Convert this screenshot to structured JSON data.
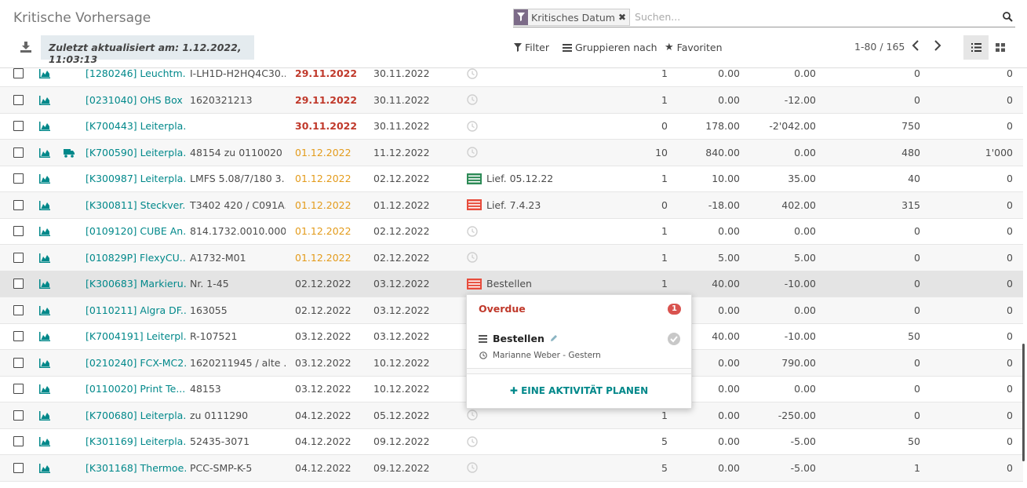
{
  "header": {
    "title": "Kritische Vorhersage",
    "facet_label": "Kritisches Datum",
    "search_placeholder": "Suchen...",
    "updated_label": "Zuletzt aktualisiert am: 1.12.2022, 11:03:13",
    "filter_label": "Filter",
    "group_label": "Gruppieren nach",
    "favorites_label": "Favoriten",
    "pager": "1-80 / 165"
  },
  "colors": {
    "accent": "#00888a",
    "overdue_red": "#c0392b",
    "warning_orange": "#e39b1b",
    "facet_purple": "#7c6b88"
  },
  "rows": [
    {
      "name": "[1280246] Leuchtm...",
      "ref": "I-LH1D-H2HQ4C30...",
      "date1": "29.11.2022",
      "date1_style": "red",
      "date2": "30.11.2022",
      "activity_icon": "clock-icon",
      "activity_label": "",
      "n1": "1",
      "n2": "0.00",
      "n3": "0.00",
      "n4": "0",
      "n5": "0",
      "truck": false
    },
    {
      "name": "[0231040] OHS Box ...",
      "ref": "1620321213",
      "date1": "29.11.2022",
      "date1_style": "red",
      "date2": "30.11.2022",
      "activity_icon": "clock-icon",
      "activity_label": "",
      "n1": "1",
      "n2": "0.00",
      "n3": "-12.00",
      "n4": "0",
      "n5": "0",
      "truck": false
    },
    {
      "name": "[K700443] Leiterpla...",
      "ref": "",
      "date1": "30.11.2022",
      "date1_style": "red",
      "date2": "30.11.2022",
      "activity_icon": "clock-icon",
      "activity_label": "",
      "n1": "0",
      "n2": "178.00",
      "n3": "-2'042.00",
      "n4": "750",
      "n5": "0",
      "truck": false
    },
    {
      "name": "[K700590] Leiterpla...",
      "ref": "48154 zu 0110020",
      "date1": "01.12.2022",
      "date1_style": "orange",
      "date2": "11.12.2022",
      "activity_icon": "clock-icon",
      "activity_label": "",
      "n1": "10",
      "n2": "840.00",
      "n3": "0.00",
      "n4": "480",
      "n5": "1'000",
      "truck": true
    },
    {
      "name": "[K300987] Leiterpla...",
      "ref": "LMFS 5.08/7/180 3...",
      "date1": "01.12.2022",
      "date1_style": "orange",
      "date2": "02.12.2022",
      "activity_icon": "list-green-icon",
      "activity_label": "Lief. 05.12.22",
      "n1": "1",
      "n2": "10.00",
      "n3": "35.00",
      "n4": "40",
      "n5": "0",
      "truck": false
    },
    {
      "name": "[K300811] Steckver...",
      "ref": "T3402 420 / C091A...",
      "date1": "01.12.2022",
      "date1_style": "orange",
      "date2": "01.12.2022",
      "activity_icon": "list-red-icon",
      "activity_label": "Lief. 7.4.23",
      "n1": "0",
      "n2": "-18.00",
      "n3": "402.00",
      "n4": "315",
      "n5": "0",
      "truck": false
    },
    {
      "name": "[0109120] CUBE An...",
      "ref": "814.1732.0010.000",
      "date1": "01.12.2022",
      "date1_style": "orange",
      "date2": "02.12.2022",
      "activity_icon": "clock-icon",
      "activity_label": "",
      "n1": "1",
      "n2": "0.00",
      "n3": "0.00",
      "n4": "0",
      "n5": "0",
      "truck": false
    },
    {
      "name": "[010829P] FlexyCU...",
      "ref": "A1732-M01",
      "date1": "01.12.2022",
      "date1_style": "orange",
      "date2": "02.12.2022",
      "activity_icon": "clock-icon",
      "activity_label": "",
      "n1": "1",
      "n2": "5.00",
      "n3": "5.00",
      "n4": "0",
      "n5": "0",
      "truck": false
    },
    {
      "name": "[K300683] Markieru...",
      "ref": "Nr. 1-45",
      "date1": "02.12.2022",
      "date1_style": "",
      "date2": "03.12.2022",
      "activity_icon": "list-red-icon",
      "activity_label": "Bestellen",
      "n1": "1",
      "n2": "40.00",
      "n3": "-10.00",
      "n4": "0",
      "n5": "0",
      "truck": false
    },
    {
      "name": "[0110211] Algra DF...",
      "ref": "163055",
      "date1": "02.12.2022",
      "date1_style": "",
      "date2": "03.12.2022",
      "activity_icon": "clock-icon",
      "activity_label": "",
      "n1": "",
      "n2": "0.00",
      "n3": "0.00",
      "n4": "0",
      "n5": "0",
      "truck": false
    },
    {
      "name": "[K7004191] Leiterpl...",
      "ref": "R-107521",
      "date1": "03.12.2022",
      "date1_style": "",
      "date2": "03.12.2022",
      "activity_icon": "clock-icon",
      "activity_label": "",
      "n1": "",
      "n2": "40.00",
      "n3": "-10.00",
      "n4": "50",
      "n5": "0",
      "truck": false
    },
    {
      "name": "[0210240] FCX-MC2...",
      "ref": "1620211945 / alte ...",
      "date1": "03.12.2022",
      "date1_style": "",
      "date2": "10.12.2022",
      "activity_icon": "clock-icon",
      "activity_label": "",
      "n1": "",
      "n2": "0.00",
      "n3": "790.00",
      "n4": "0",
      "n5": "0",
      "truck": false
    },
    {
      "name": "[0110020] Print Te...",
      "ref": "48153",
      "date1": "03.12.2022",
      "date1_style": "",
      "date2": "10.12.2022",
      "activity_icon": "clock-icon",
      "activity_label": "",
      "n1": "",
      "n2": "0.00",
      "n3": "0.00",
      "n4": "0",
      "n5": "0",
      "truck": false
    },
    {
      "name": "[K700680] Leiterpla...",
      "ref": "zu 0111290",
      "date1": "04.12.2022",
      "date1_style": "",
      "date2": "05.12.2022",
      "activity_icon": "clock-icon",
      "activity_label": "",
      "n1": "1",
      "n2": "0.00",
      "n3": "-250.00",
      "n4": "0",
      "n5": "0",
      "truck": false
    },
    {
      "name": "[K301169] Leiterpla...",
      "ref": "52435-3071",
      "date1": "04.12.2022",
      "date1_style": "",
      "date2": "09.12.2022",
      "activity_icon": "clock-icon",
      "activity_label": "",
      "n1": "5",
      "n2": "0.00",
      "n3": "-5.00",
      "n4": "50",
      "n5": "0",
      "truck": false
    },
    {
      "name": "[K301168] Thermoe...",
      "ref": "PCC-SMP-K-5",
      "date1": "04.12.2022",
      "date1_style": "",
      "date2": "09.12.2022",
      "activity_icon": "clock-icon",
      "activity_label": "",
      "n1": "5",
      "n2": "0.00",
      "n3": "-5.00",
      "n4": "1",
      "n5": "0",
      "truck": false
    }
  ],
  "popover": {
    "title": "Overdue",
    "badge": "1",
    "activity_label": "Bestellen",
    "meta": "Marianne Weber - Gestern",
    "plan_label": "EINE AKTIVITÄT PLANEN"
  }
}
